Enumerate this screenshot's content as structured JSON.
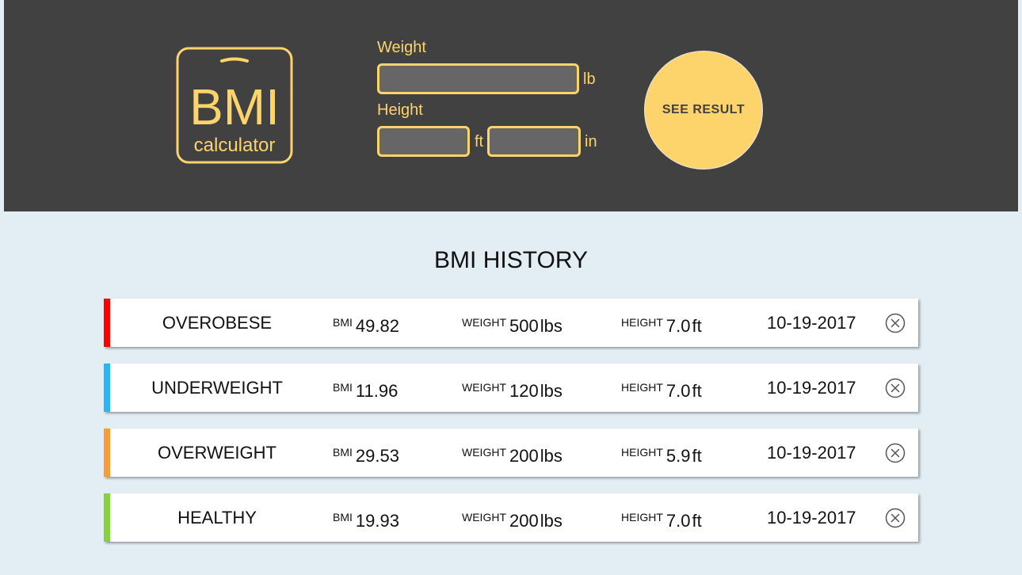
{
  "logo": {
    "main_text": "BMI",
    "sub_text": "calculator",
    "color": "#fdd36b"
  },
  "form": {
    "weight_label": "Weight",
    "weight_value": "",
    "weight_unit": "lb",
    "height_label": "Height",
    "height_ft_value": "",
    "height_ft_unit": "ft",
    "height_in_value": "",
    "height_in_unit": "in",
    "submit_label": "SEE RESULT"
  },
  "history": {
    "title": "BMI HISTORY",
    "rows": [
      {
        "status": "OVEROBESE",
        "color": "#ff0000",
        "bmi_label": "BMI",
        "bmi": "49.82",
        "weight_label": "WEIGHT",
        "weight": "500",
        "weight_unit": "lbs",
        "height_label": "HEIGHT",
        "height": "7.0",
        "height_unit": "ft",
        "date": "10-19-2017"
      },
      {
        "status": "UNDERWEIGHT",
        "color": "#29b6f6",
        "bmi_label": "BMI",
        "bmi": "11.96",
        "weight_label": "WEIGHT",
        "weight": "120",
        "weight_unit": "lbs",
        "height_label": "HEIGHT",
        "height": "7.0",
        "height_unit": "ft",
        "date": "10-19-2017"
      },
      {
        "status": "OVERWEIGHT",
        "color": "#fa9b38",
        "bmi_label": "BMI",
        "bmi": "29.53",
        "weight_label": "WEIGHT",
        "weight": "200",
        "weight_unit": "lbs",
        "height_label": "HEIGHT",
        "height": "5.9",
        "height_unit": "ft",
        "date": "10-19-2017"
      },
      {
        "status": "HEALTHY",
        "color": "#82d33c",
        "bmi_label": "BMI",
        "bmi": "19.93",
        "weight_label": "WEIGHT",
        "weight": "200",
        "weight_unit": "lbs",
        "height_label": "HEIGHT",
        "height": "7.0",
        "height_unit": "ft",
        "date": "10-19-2017"
      }
    ]
  },
  "icons": {
    "logo": "scale-logo-icon",
    "remove": "close-circle-icon"
  }
}
